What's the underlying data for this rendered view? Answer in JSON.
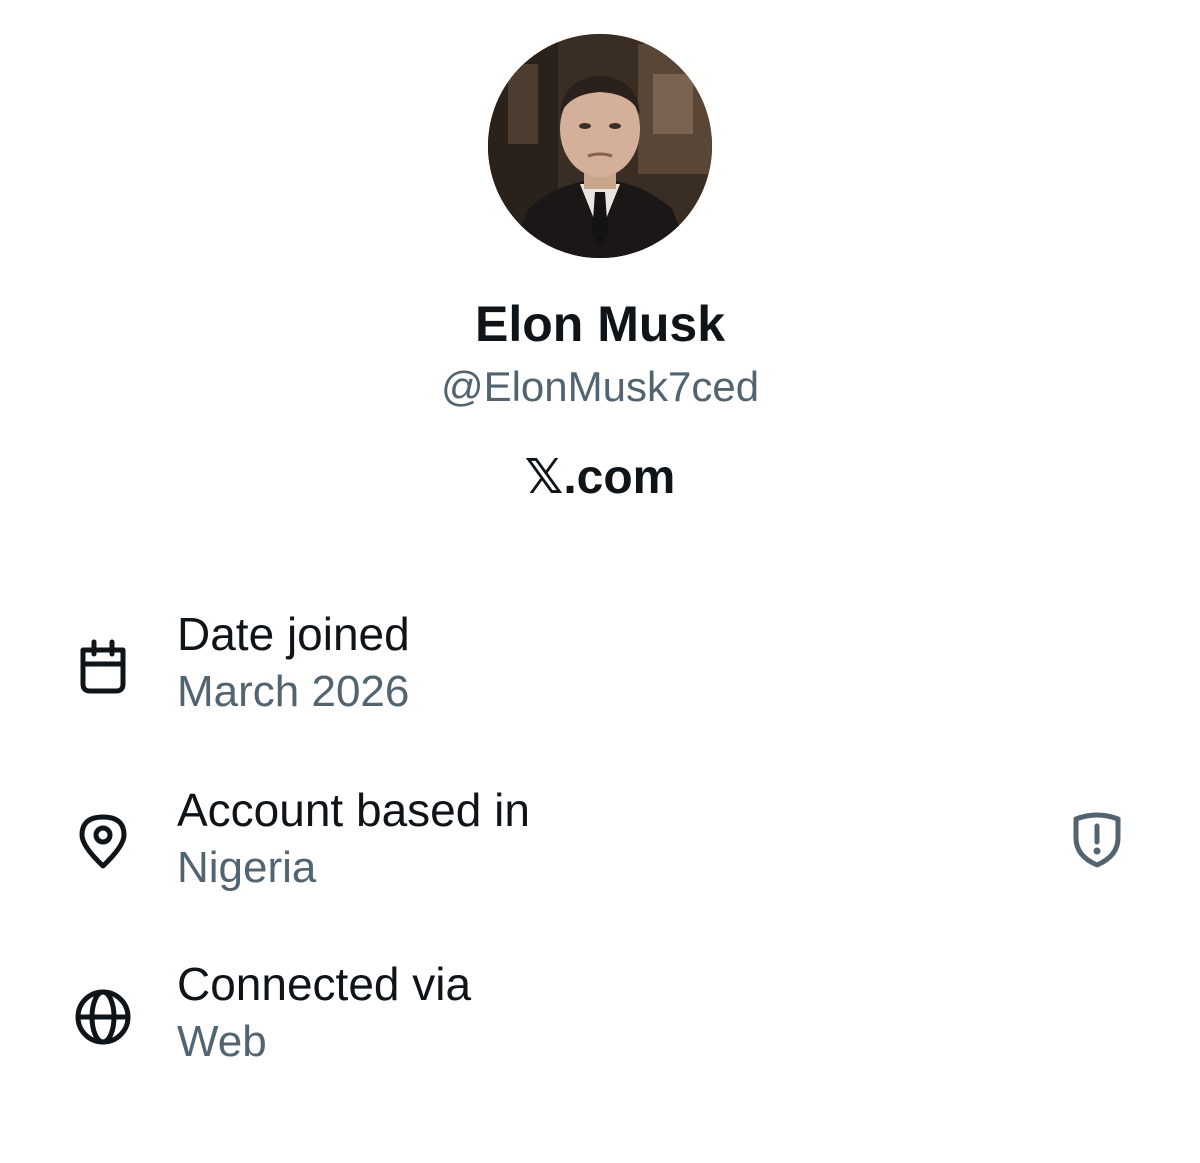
{
  "profile": {
    "display_name": "Elon Musk",
    "handle": "@ElonMusk7ced",
    "website": "𝕏.com",
    "avatar_icon": "profile-photo"
  },
  "about": {
    "joined": {
      "label": "Date joined",
      "value": "March 2026",
      "icon": "calendar-icon"
    },
    "location": {
      "label": "Account based in",
      "value": "Nigeria",
      "icon": "location-pin-icon",
      "badge_icon": "shield-alert-icon"
    },
    "connected": {
      "label": "Connected via",
      "value": "Web",
      "icon": "globe-icon"
    }
  },
  "colors": {
    "primary_text": "#0f1419",
    "secondary_text": "#536471",
    "background": "#ffffff"
  }
}
